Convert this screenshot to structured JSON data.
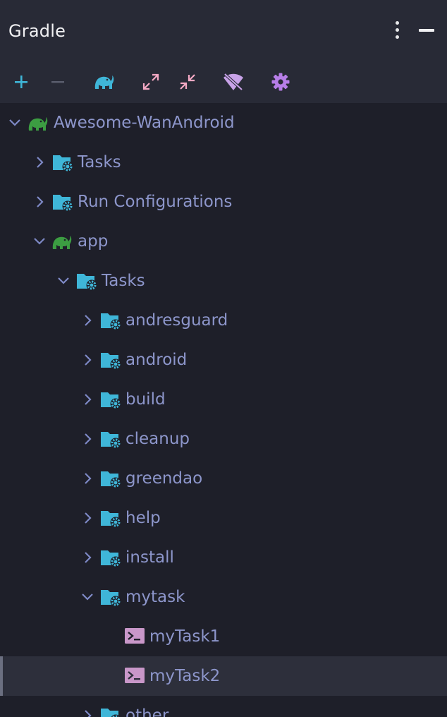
{
  "panel": {
    "title": "Gradle",
    "options_icon": "kebab-menu-icon",
    "minimize_icon": "minimize-icon"
  },
  "toolbar": {
    "buttons": [
      {
        "name": "add",
        "icon": "plus-icon",
        "color": "#3fb6d8"
      },
      {
        "name": "remove",
        "icon": "minus-icon",
        "color": "#5b5e6e"
      },
      {
        "name": "gradle",
        "icon": "gradle-elephant-icon",
        "color": "#3fb6d8"
      },
      {
        "name": "expand-all",
        "icon": "expand-icon",
        "color": "#f4a9c4"
      },
      {
        "name": "collapse-all",
        "icon": "collapse-icon",
        "color": "#f4a9c4"
      },
      {
        "name": "offline-mode",
        "icon": "wifi-off-icon",
        "color": "#c8a2e8"
      },
      {
        "name": "settings",
        "icon": "gear-icon",
        "color": "#b77ee8"
      }
    ]
  },
  "tree": {
    "items": [
      {
        "label": "Awesome-WanAndroid",
        "icon": "gradle-project-icon",
        "expanded": true
      },
      {
        "label": "Tasks",
        "icon": "task-folder-icon",
        "expanded": false
      },
      {
        "label": "Run Configurations",
        "icon": "task-folder-icon",
        "expanded": false
      },
      {
        "label": "app",
        "icon": "gradle-project-icon",
        "expanded": true
      },
      {
        "label": "Tasks",
        "icon": "task-folder-icon",
        "expanded": true
      },
      {
        "label": "andresguard",
        "icon": "task-folder-icon",
        "expanded": false
      },
      {
        "label": "android",
        "icon": "task-folder-icon",
        "expanded": false
      },
      {
        "label": "build",
        "icon": "task-folder-icon",
        "expanded": false
      },
      {
        "label": "cleanup",
        "icon": "task-folder-icon",
        "expanded": false
      },
      {
        "label": "greendao",
        "icon": "task-folder-icon",
        "expanded": false
      },
      {
        "label": "help",
        "icon": "task-folder-icon",
        "expanded": false
      },
      {
        "label": "install",
        "icon": "task-folder-icon",
        "expanded": false
      },
      {
        "label": "mytask",
        "icon": "task-folder-icon",
        "expanded": true
      },
      {
        "label": "myTask1",
        "icon": "terminal-task-icon",
        "selected": false
      },
      {
        "label": "myTask2",
        "icon": "terminal-task-icon",
        "selected": true
      },
      {
        "label": "other",
        "icon": "task-folder-icon",
        "expanded": false
      }
    ]
  },
  "colors": {
    "background": "#1e1f29",
    "header_background": "#282a36",
    "label": "#8d96cb",
    "folder": "#3fb6d8",
    "gradle_green": "#3c9d42",
    "task_icon": "#c997c9",
    "chevron": "#7e89c6",
    "selected_row": "#2d2f3b"
  }
}
